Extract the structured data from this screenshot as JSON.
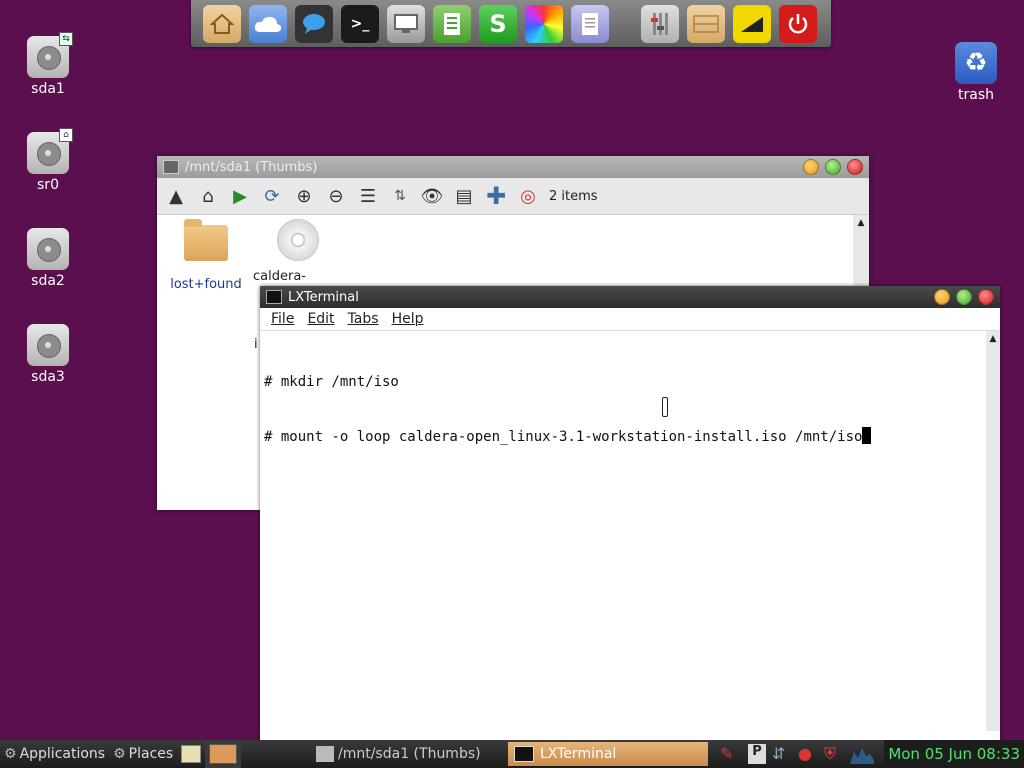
{
  "dock": {
    "icons": [
      "home-folder-icon",
      "cloud-icon",
      "chat-icon",
      "terminal-icon",
      "display-icon",
      "document-icon",
      "spreadsheet-icon",
      "color-wheel-icon",
      "text-editor-icon",
      "settings-icon",
      "drawer-icon",
      "ruler-icon",
      "power-icon"
    ],
    "terminal_glyph": ">_",
    "spreadsheet_glyph": "S"
  },
  "desktop": {
    "icons": [
      {
        "label": "sda1",
        "icon": "hard-drive-icon"
      },
      {
        "label": "sr0",
        "icon": "optical-drive-icon"
      },
      {
        "label": "sda2",
        "icon": "hard-drive-icon"
      },
      {
        "label": "sda3",
        "icon": "hard-drive-icon"
      },
      {
        "label": "trash",
        "icon": "recycle-icon"
      }
    ]
  },
  "file_manager": {
    "title": "/mnt/sda1 (Thumbs)",
    "item_count": "2 items",
    "items": [
      {
        "label": "lost+found",
        "icon": "folder-icon"
      },
      {
        "label": "caldera-",
        "icon": "disc-icon"
      }
    ],
    "partial_chars": [
      "i"
    ]
  },
  "terminal": {
    "title": "LXTerminal",
    "menu": [
      "File",
      "Edit",
      "Tabs",
      "Help"
    ],
    "lines": [
      "# mkdir /mnt/iso",
      "# mount -o loop caldera-open_linux-3.1-workstation-install.iso /mnt/iso"
    ]
  },
  "taskbar": {
    "applications": "Applications",
    "places": "Places",
    "tasks": [
      "/mnt/sda1 (Thumbs)",
      "LXTerminal"
    ],
    "clock": "Mon 05 Jun 08:33"
  },
  "colors": {
    "desktop": "#5b0f4f",
    "clock": "#4fe26a",
    "active_task": "#d99a5a"
  }
}
